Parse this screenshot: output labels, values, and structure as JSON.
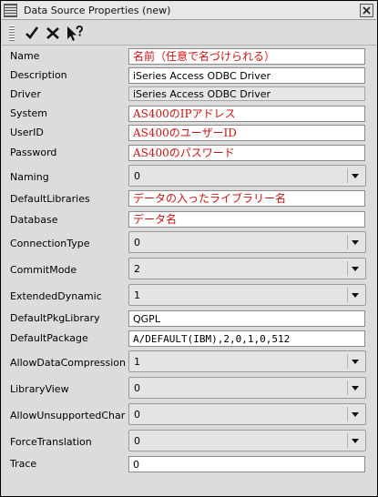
{
  "window": {
    "title": "Data Source Properties (new)"
  },
  "toolbar": {
    "buttons": [
      {
        "name": "apply",
        "icon": "checkmark-icon"
      },
      {
        "name": "cancel",
        "icon": "x-icon"
      },
      {
        "name": "help",
        "icon": "help-pointer-icon"
      }
    ]
  },
  "fields": {
    "name": {
      "label": "Name",
      "value": "名前（任意で名づけられる）"
    },
    "description": {
      "label": "Description",
      "value": "iSeries Access ODBC Driver"
    },
    "driver": {
      "label": "Driver",
      "value": "iSeries Access ODBC Driver"
    },
    "system": {
      "label": "System",
      "value": "AS400のIPアドレス"
    },
    "userid": {
      "label": "UserID",
      "value": "AS400のユーザーID"
    },
    "password": {
      "label": "Password",
      "value": "AS400のパスワード"
    },
    "naming": {
      "label": "Naming",
      "value": "0"
    },
    "defaultlibraries": {
      "label": "DefaultLibraries",
      "value": "データの入ったライブラリー名"
    },
    "database": {
      "label": "Database",
      "value": "データ名"
    },
    "connectiontype": {
      "label": "ConnectionType",
      "value": "0"
    },
    "commitmode": {
      "label": "CommitMode",
      "value": "2"
    },
    "extendeddynamic": {
      "label": "ExtendedDynamic",
      "value": "1"
    },
    "defaultpkglibrary": {
      "label": "DefaultPkgLibrary",
      "value": "QGPL"
    },
    "defaultpackage": {
      "label": "DefaultPackage",
      "value": "A/DEFAULT(IBM),2,0,1,0,512"
    },
    "allowdatacompression": {
      "label": "AllowDataCompression",
      "value": "1"
    },
    "libraryview": {
      "label": "LibraryView",
      "value": "0"
    },
    "allowunsupportedchar": {
      "label": "AllowUnsupportedChar",
      "value": "0"
    },
    "forcetranslation": {
      "label": "ForceTranslation",
      "value": "0"
    },
    "trace": {
      "label": "Trace",
      "value": "0"
    }
  },
  "colors": {
    "japanese_text": "#c81414",
    "window_bg": "#dcdcdc"
  }
}
